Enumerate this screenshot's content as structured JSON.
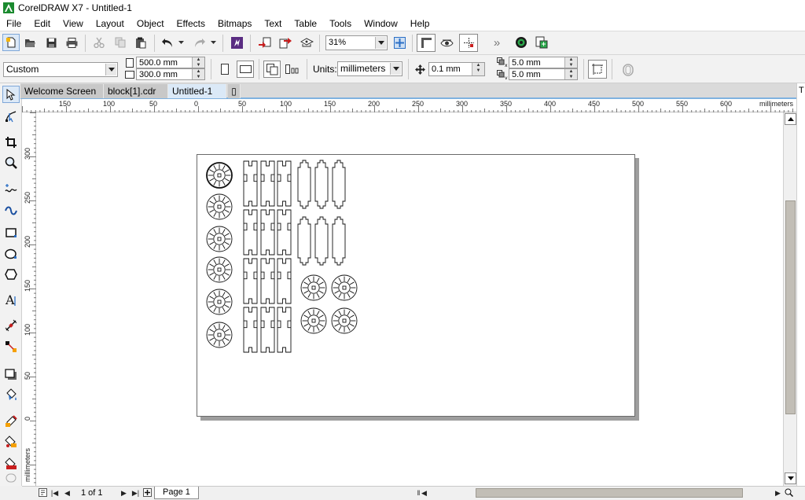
{
  "window": {
    "title": "CorelDRAW X7 - Untitled-1"
  },
  "menu": [
    "File",
    "Edit",
    "View",
    "Layout",
    "Object",
    "Effects",
    "Bitmaps",
    "Text",
    "Table",
    "Tools",
    "Window",
    "Help"
  ],
  "toolbar": {
    "zoom": "31%"
  },
  "propertybar": {
    "page_preset": "Custom",
    "width": "500.0 mm",
    "height": "300.0 mm",
    "units_label": "Units:",
    "units": "millimeters",
    "nudge": "0.1 mm",
    "dup_x": "5.0 mm",
    "dup_y": "5.0 mm"
  },
  "tabs": [
    {
      "label": "Welcome Screen",
      "active": false
    },
    {
      "label": "block[1].cdr",
      "active": false
    },
    {
      "label": "Untitled-1",
      "active": true
    }
  ],
  "ruler": {
    "unit": "millimeters",
    "h_labels": [
      "150",
      "100",
      "50",
      "0",
      "50",
      "100",
      "150",
      "200",
      "250",
      "300",
      "350",
      "400",
      "450",
      "500",
      "550",
      "600"
    ],
    "v_labels": [
      "300",
      "250",
      "200",
      "150",
      "100",
      "50",
      "0"
    ]
  },
  "status": {
    "page_count": "1 of 1",
    "page_name": "Page 1"
  },
  "icons": {
    "accent": "#2b6fc6",
    "right_strip_glyph": "T"
  }
}
